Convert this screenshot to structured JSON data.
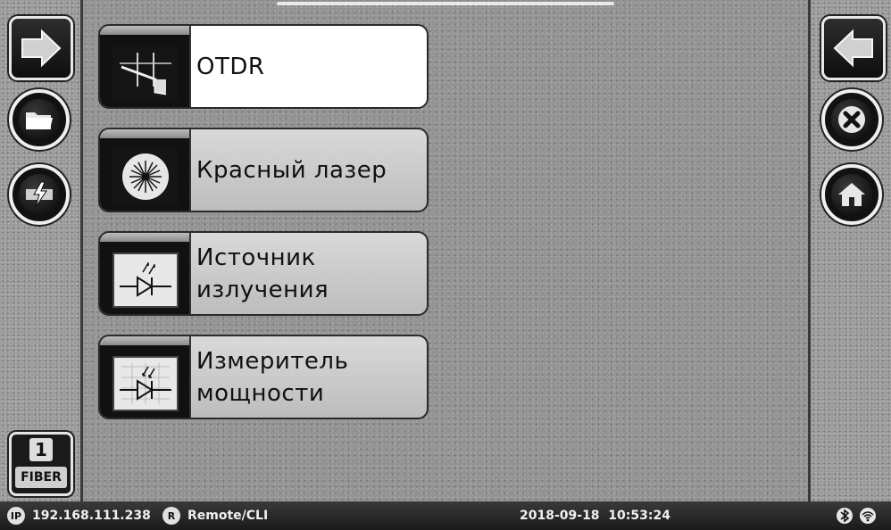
{
  "menu": {
    "items": [
      {
        "label": "OTDR",
        "icon": "otdr-trace-icon",
        "active": true
      },
      {
        "label": "Красный лазер",
        "icon": "red-laser-icon",
        "active": false
      },
      {
        "label": "Источник излучения",
        "icon": "light-source-icon",
        "active": false
      },
      {
        "label": "Измеритель мощности",
        "icon": "power-meter-icon",
        "active": false
      }
    ]
  },
  "left_toolbar": {
    "buttons": [
      {
        "name": "forward-arrow-button",
        "icon": "arrow-right-icon"
      },
      {
        "name": "open-folder-button",
        "icon": "folder-icon"
      },
      {
        "name": "fiber-check-button",
        "icon": "fiber-check-icon"
      }
    ]
  },
  "right_toolbar": {
    "buttons": [
      {
        "name": "back-arrow-button",
        "icon": "arrow-left-icon"
      },
      {
        "name": "close-button",
        "icon": "close-icon"
      },
      {
        "name": "home-button",
        "icon": "home-icon"
      }
    ]
  },
  "fiber": {
    "number": "1",
    "label": "FIBER"
  },
  "status_bar": {
    "ip_badge": "IP",
    "ip_address": "192.168.111.238",
    "remote_badge": "R",
    "remote_mode": "Remote/CLI",
    "datetime": "2018-09-18  10:53:24",
    "icons": [
      "bluetooth-icon",
      "wifi-icon"
    ]
  }
}
